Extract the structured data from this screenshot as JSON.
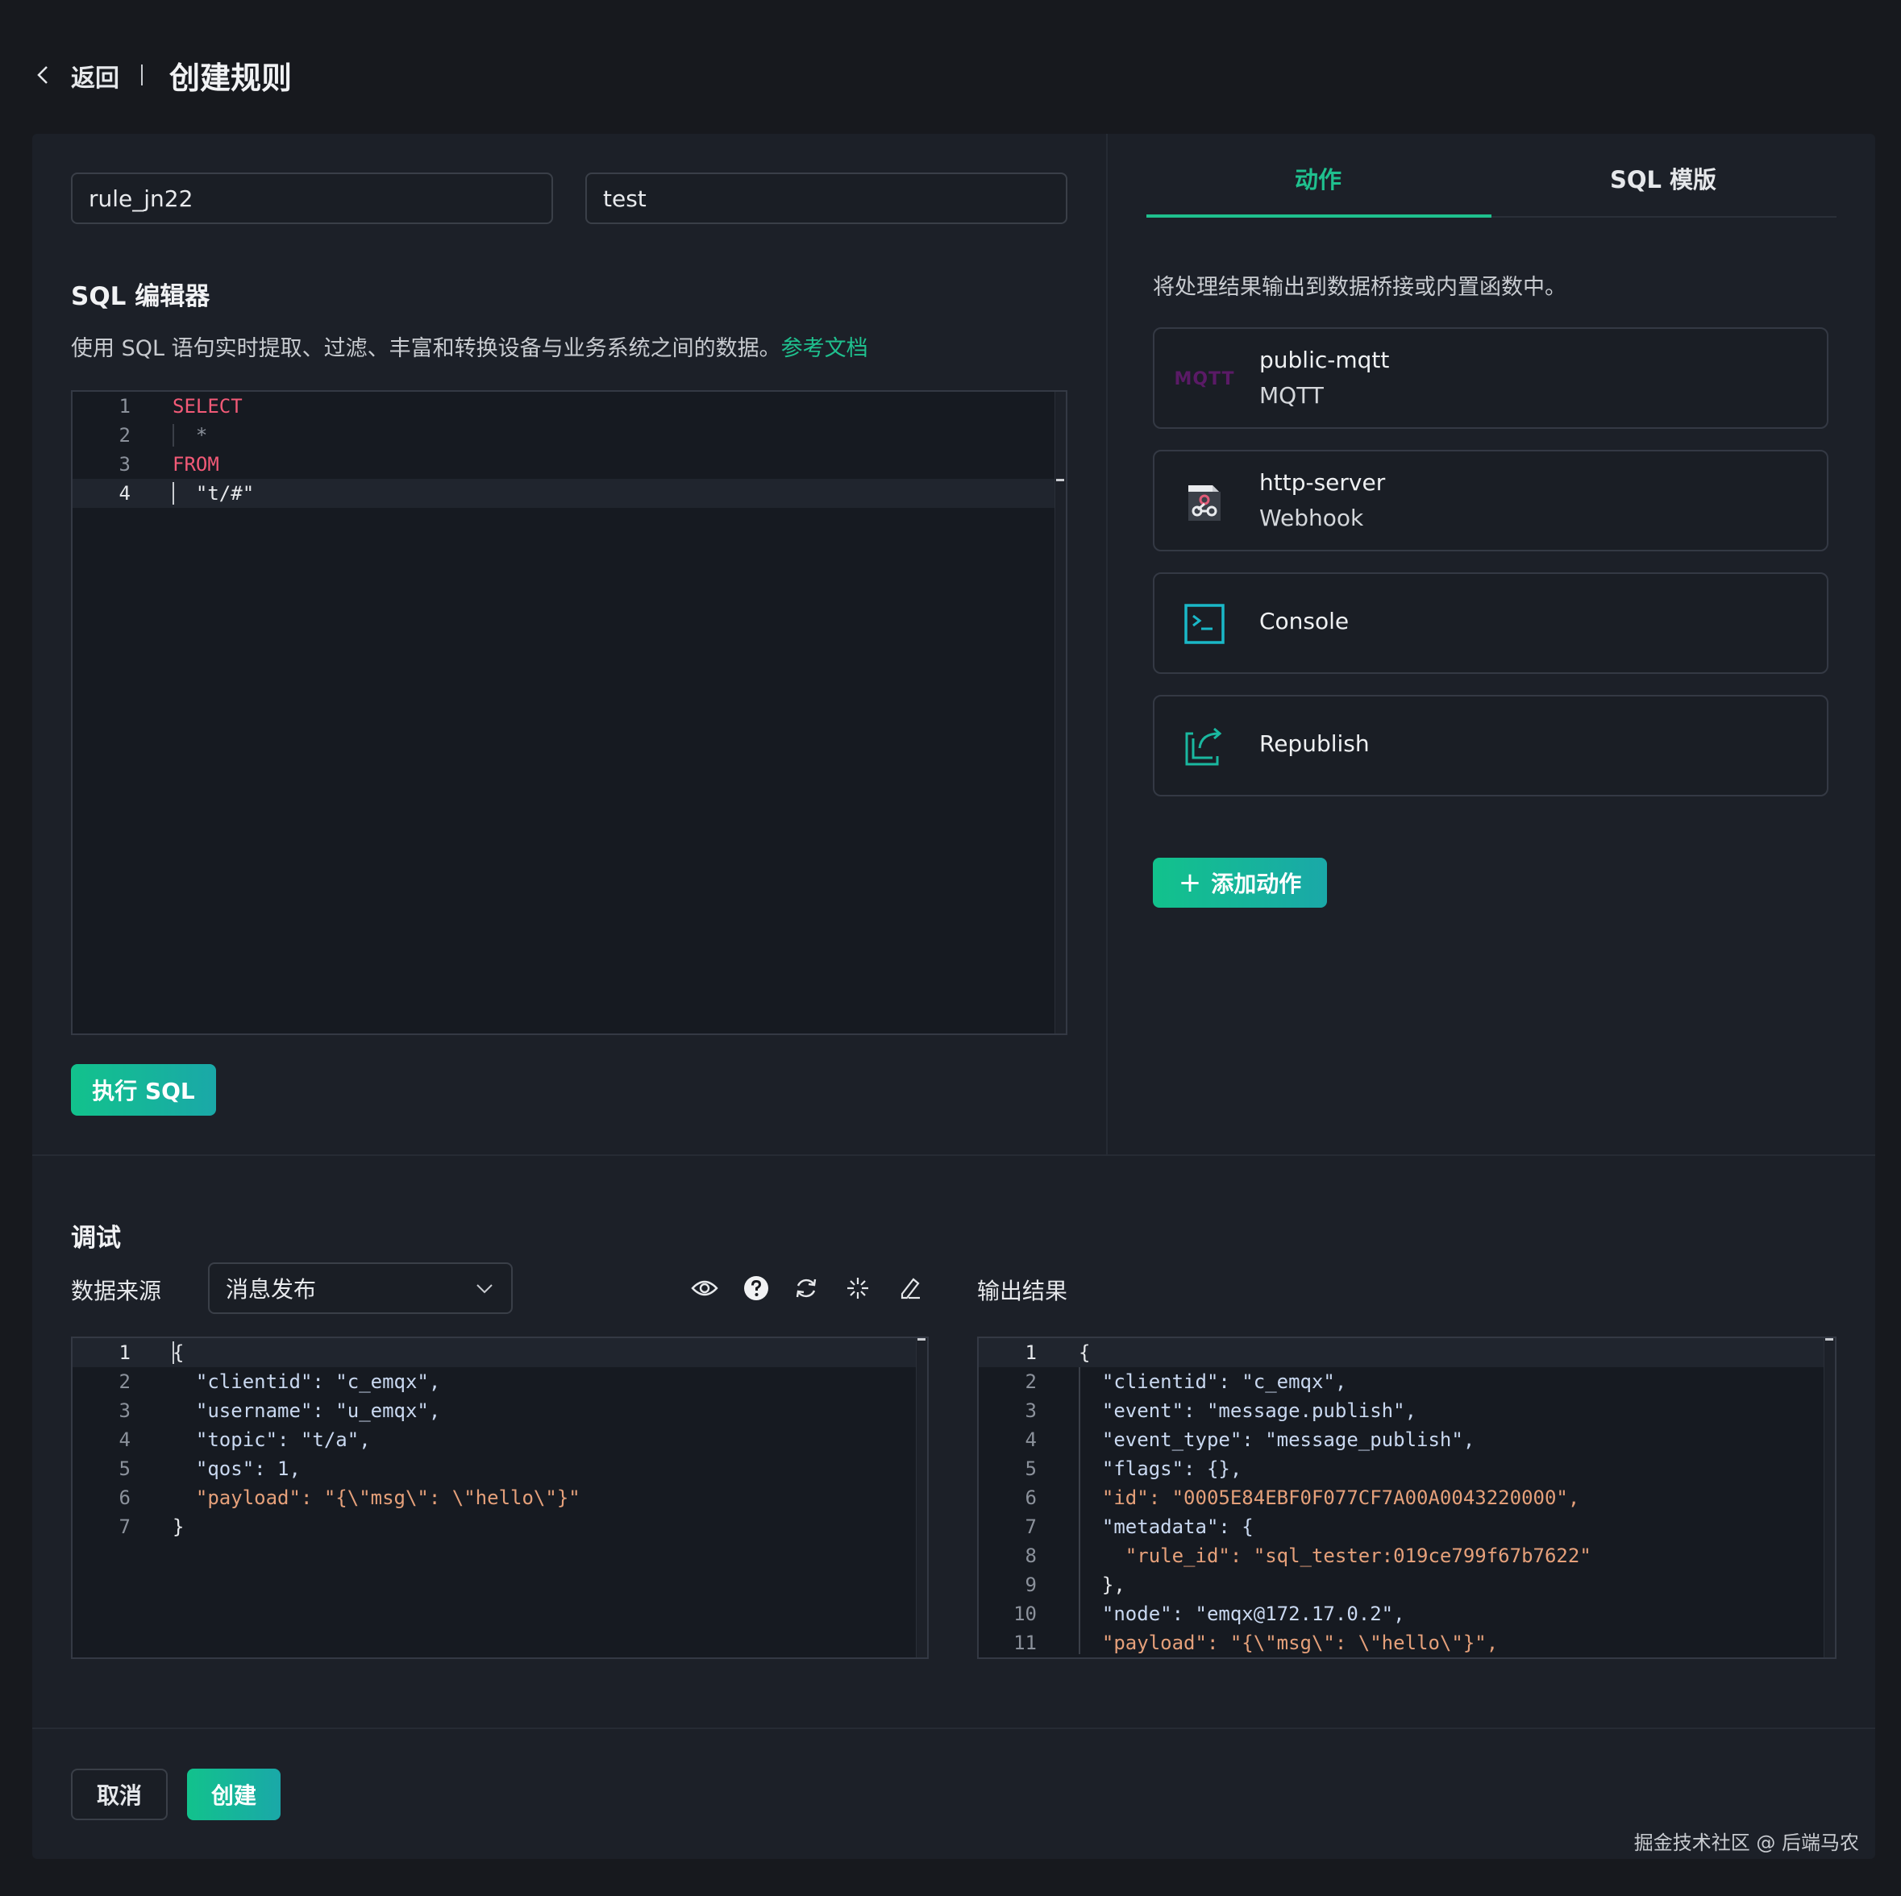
{
  "header": {
    "back_label": "返回",
    "title": "创建规则"
  },
  "rule_form": {
    "rule_id_value": "rule_jn22",
    "description_value": "test"
  },
  "sql_editor": {
    "title": "SQL 编辑器",
    "description": "使用 SQL 语句实时提取、过滤、丰富和转换设备与业务系统之间的数据。",
    "doc_link": "参考文档",
    "lines": [
      {
        "n": "1",
        "text": "SELECT"
      },
      {
        "n": "2",
        "text": "  *"
      },
      {
        "n": "3",
        "text": "FROM"
      },
      {
        "n": "4",
        "text": "  \"t/#\""
      }
    ],
    "run_label": "执行 SQL"
  },
  "tabs": [
    {
      "label": "动作"
    },
    {
      "label": "SQL 模版"
    }
  ],
  "actions": {
    "description": "将处理结果输出到数据桥接或内置函数中。",
    "items": [
      {
        "name": "public-mqtt",
        "type": "MQTT",
        "icon": "mqtt-icon",
        "icon_text": "MQTT"
      },
      {
        "name": "http-server",
        "type": "Webhook",
        "icon": "webhook-icon"
      },
      {
        "name": "Console",
        "type": "",
        "icon": "console-icon"
      },
      {
        "name": "Republish",
        "type": "",
        "icon": "republish-icon"
      }
    ],
    "add_label": "添加动作"
  },
  "debug": {
    "title": "调试",
    "source_label": "数据来源",
    "source_value": "消息发布",
    "output_label": "输出结果",
    "input_lines": [
      {
        "n": "1",
        "text": "{"
      },
      {
        "n": "2",
        "text": "  \"clientid\": \"c_emqx\","
      },
      {
        "n": "3",
        "text": "  \"username\": \"u_emqx\","
      },
      {
        "n": "4",
        "text": "  \"topic\": \"t/a\","
      },
      {
        "n": "5",
        "text": "  \"qos\": 1,"
      },
      {
        "n": "6",
        "text": "  \"payload\": \"{\\\"msg\\\": \\\"hello\\\"}\""
      },
      {
        "n": "7",
        "text": "}"
      }
    ],
    "output_lines": [
      {
        "n": "1",
        "text": "{"
      },
      {
        "n": "2",
        "text": "  \"clientid\": \"c_emqx\","
      },
      {
        "n": "3",
        "text": "  \"event\": \"message.publish\","
      },
      {
        "n": "4",
        "text": "  \"event_type\": \"message_publish\","
      },
      {
        "n": "5",
        "text": "  \"flags\": {},"
      },
      {
        "n": "6",
        "text": "  \"id\": \"0005E84EBF0F077CF7A00A0043220000\","
      },
      {
        "n": "7",
        "text": "  \"metadata\": {"
      },
      {
        "n": "8",
        "text": "    \"rule_id\": \"sql_tester:019ce799f67b7622\""
      },
      {
        "n": "9",
        "text": "  },"
      },
      {
        "n": "10",
        "text": "  \"node\": \"emqx@172.17.0.2\","
      },
      {
        "n": "11",
        "text": "  \"payload\": \"{\\\"msg\\\": \\\"hello\\\"}\","
      }
    ]
  },
  "footer": {
    "cancel_label": "取消",
    "create_label": "创建",
    "watermark": "掘金技术社区 @ 后端马农"
  },
  "colors": {
    "accent": "#1fc08e",
    "background": "#17191e",
    "panel": "#1c2028"
  }
}
